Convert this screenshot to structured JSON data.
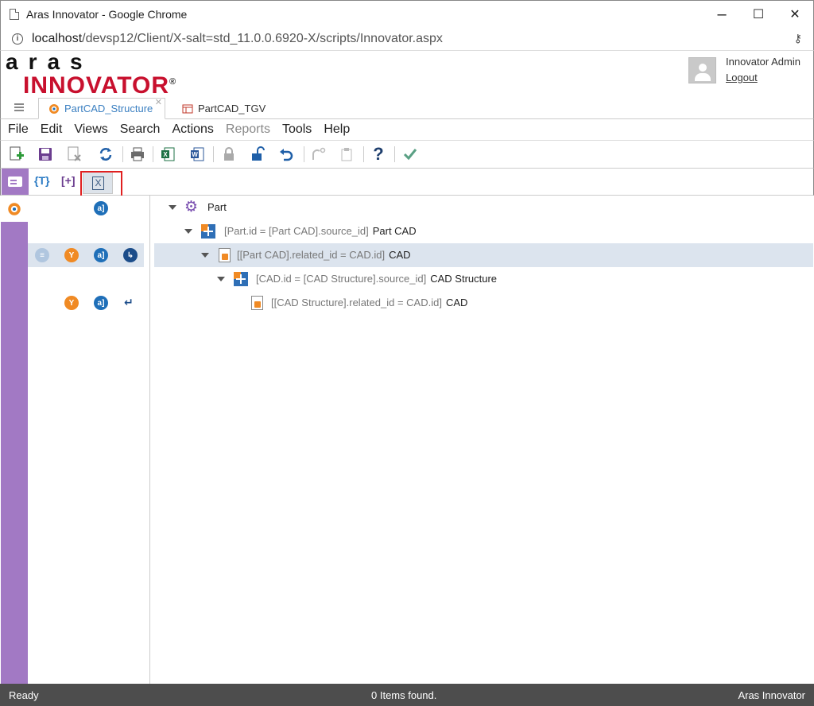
{
  "window": {
    "title": "Aras Innovator - Google Chrome",
    "url_host": "localhost",
    "url_path": "/devsp12/Client/X-salt=std_11.0.0.6920-X/scripts/Innovator.aspx"
  },
  "header": {
    "logo_top": "aras",
    "logo_bottom": "INNOVATOR",
    "logo_mark": "®",
    "user_name": "Innovator Admin",
    "logout_label": "Logout"
  },
  "tabs": [
    {
      "label": "PartCAD_Structure",
      "active": true
    },
    {
      "label": "PartCAD_TGV",
      "active": false
    }
  ],
  "menu": [
    {
      "label": "File"
    },
    {
      "label": "Edit"
    },
    {
      "label": "Views"
    },
    {
      "label": "Search"
    },
    {
      "label": "Actions"
    },
    {
      "label": "Reports",
      "disabled": true
    },
    {
      "label": "Tools"
    },
    {
      "label": "Help"
    }
  ],
  "view_toolbar": {
    "btn1": "{T}",
    "btn2": "[+]",
    "btn3": "X"
  },
  "tree": [
    {
      "cond": "",
      "name": "Part",
      "icon": "gear-icon"
    },
    {
      "cond": "[Part.id = [Part CAD].source_id]",
      "name": "Part CAD",
      "icon": "relationship-icon"
    },
    {
      "cond": "[[Part CAD].related_id = CAD.id]",
      "name": "CAD",
      "icon": "document-icon"
    },
    {
      "cond": "[CAD.id = [CAD Structure].source_id]",
      "name": "CAD Structure",
      "icon": "relationship-icon"
    },
    {
      "cond": "[[CAD Structure].related_id = CAD.id]",
      "name": "CAD",
      "icon": "document-icon"
    }
  ],
  "status": {
    "left": "Ready",
    "middle": "0 Items found.",
    "right": "Aras Innovator"
  },
  "colors": {
    "accent_purple": "#a279c4",
    "brand_red": "#c8102e",
    "selection": "#dce4ee"
  }
}
